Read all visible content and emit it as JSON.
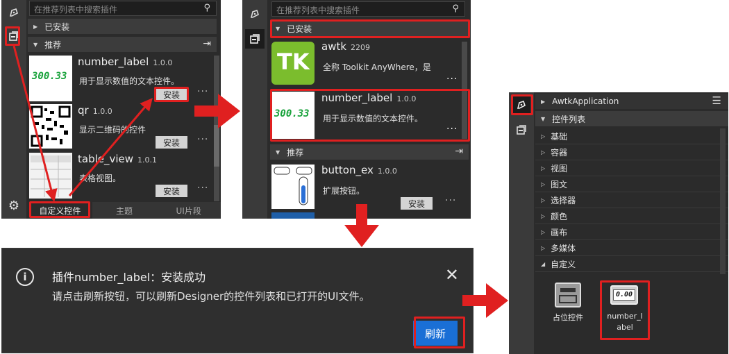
{
  "panel1": {
    "search_placeholder": "在推荐列表中搜索插件",
    "installed_label": "已安装",
    "recommended_label": "推荐",
    "plugins": [
      {
        "name": "number_label",
        "version": "1.0.0",
        "desc": "用于显示数值的文本控件。",
        "thumb": "300.33",
        "install": "安装"
      },
      {
        "name": "qr",
        "version": "1.0.0",
        "desc": "显示二维码的控件",
        "install": "安装"
      },
      {
        "name": "table_view",
        "version": "1.0.1",
        "desc": "表格视图。",
        "install": "安装"
      }
    ],
    "tabs": [
      "自定义控件",
      "主题",
      "UI片段"
    ]
  },
  "panel2": {
    "search_placeholder": "在推荐列表中搜索插件",
    "installed_label": "已安装",
    "recommended_label": "推荐",
    "installed_plugins": [
      {
        "name": "awtk",
        "version": "2209",
        "desc": "全称 Toolkit AnyWhere，是",
        "logo": "TK"
      },
      {
        "name": "number_label",
        "version": "1.0.0",
        "desc": "用于显示数值的文本控件。",
        "thumb": "300.33"
      }
    ],
    "recommended_plugins": [
      {
        "name": "button_ex",
        "version": "1.0.0",
        "desc": "扩展按钮。",
        "install": "安装"
      }
    ]
  },
  "toast": {
    "title": "插件number_label：安装成功",
    "message": "请点击刷新按钮，可以刷新Designer的控件列表和已打开的UI文件。",
    "close": "✕",
    "refresh_label": "刷新"
  },
  "panel3": {
    "app_label": "AwtkApplication",
    "widget_list_label": "控件列表",
    "categories": [
      "基础",
      "容器",
      "视图",
      "图文",
      "选择器",
      "颜色",
      "画布",
      "多媒体",
      "自定义"
    ],
    "custom_widgets": [
      {
        "label": "占位控件"
      },
      {
        "label_line1": "number_l",
        "label_line2": "abel",
        "icon_text": "0.00"
      }
    ]
  },
  "colors": {
    "accent_red": "#e02020",
    "primary_blue": "#1a6fd6",
    "number_green": "#17a23a"
  }
}
